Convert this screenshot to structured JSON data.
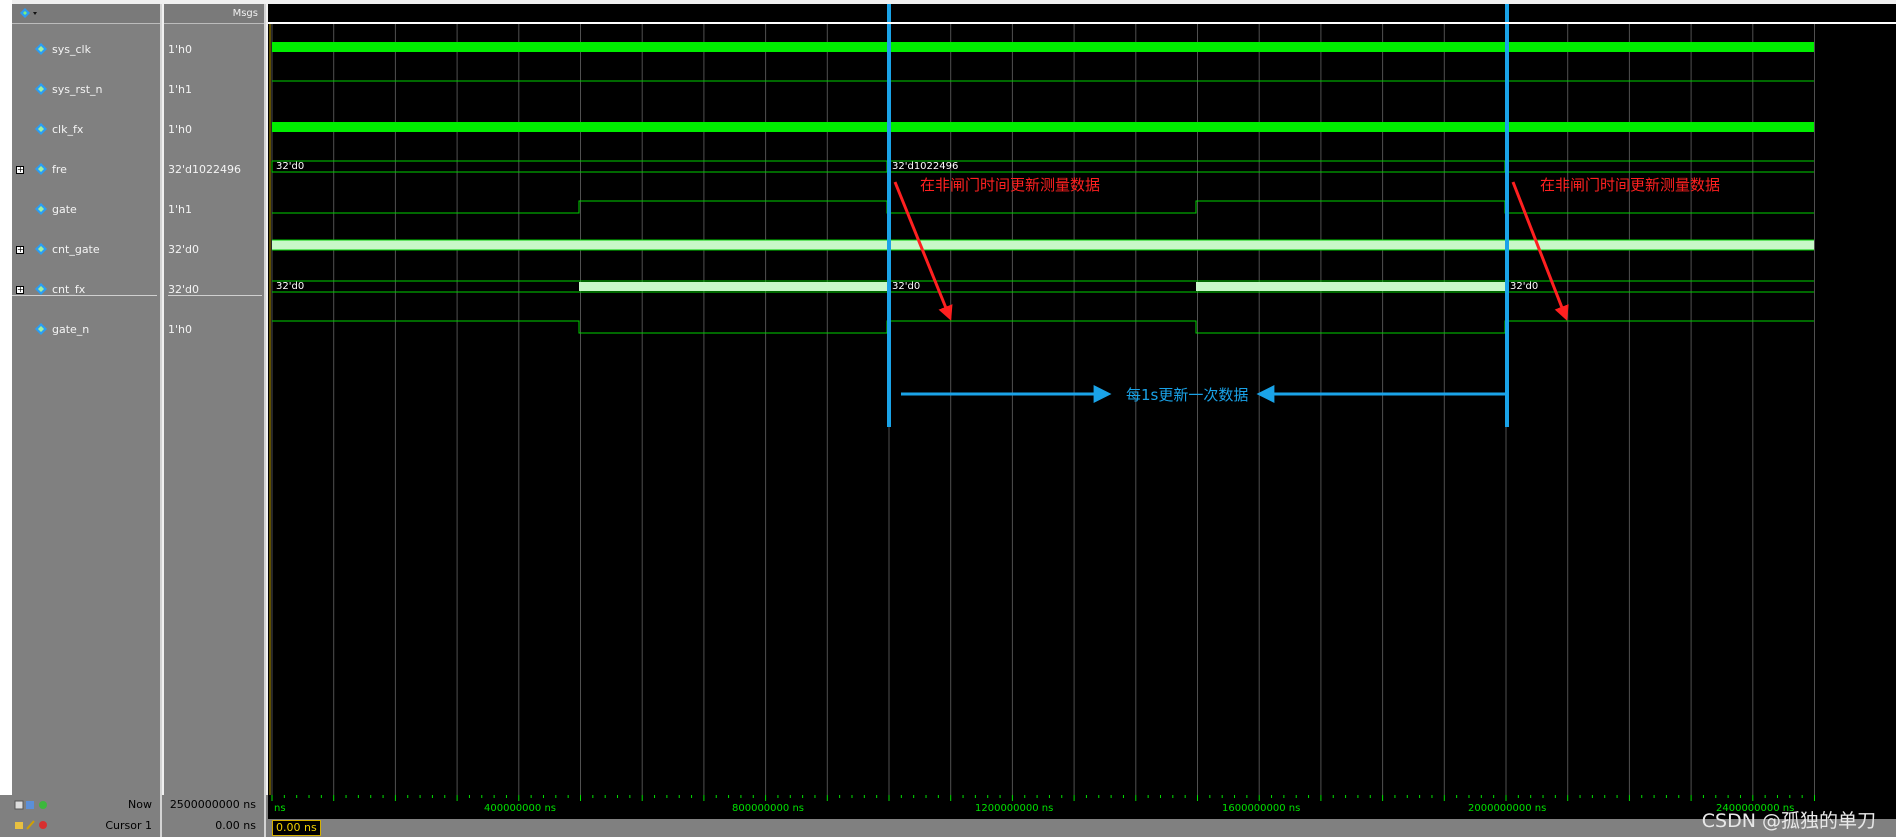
{
  "header": {
    "msgs_label": "Msgs"
  },
  "signals": [
    {
      "name": "sys_clk",
      "value": "1'h0",
      "expandable": false
    },
    {
      "name": "sys_rst_n",
      "value": "1'h1",
      "expandable": false
    },
    {
      "name": "clk_fx",
      "value": "1'h0",
      "expandable": false
    },
    {
      "name": "fre",
      "value": "32'd1022496",
      "expandable": true
    },
    {
      "name": "gate",
      "value": "1'h1",
      "expandable": false
    },
    {
      "name": "cnt_gate",
      "value": "32'd0",
      "expandable": true
    },
    {
      "name": "cnt_fx",
      "value": "32'd0",
      "expandable": true
    },
    {
      "name": "gate_n",
      "value": "1'h0",
      "expandable": false
    }
  ],
  "wave_labels": {
    "fre_start": "32'd0",
    "fre_mid": "32'd1022496",
    "cnt_fx_start": "32'd0",
    "cnt_fx_mid1": "32'd0",
    "cnt_fx_mid2": "32'd0"
  },
  "annotations": {
    "red_1": "在非闸门时间更新测量数据",
    "red_2": "在非闸门时间更新测量数据",
    "blue": "每1s更新一次数据"
  },
  "bottom": {
    "now_label": "Now",
    "now_value": "2500000000 ns",
    "cursor_label": "Cursor 1",
    "cursor_value": "0.00 ns",
    "cursor_box": "0.00 ns"
  },
  "timeline": {
    "ticks": [
      "ns",
      "400000000 ns",
      "800000000 ns",
      "1200000000 ns",
      "1600000000 ns",
      "2000000000 ns",
      "2400000000 ns"
    ]
  },
  "watermark": "CSDN @孤独的单刀",
  "colors": {
    "wave_green": "#00e000",
    "bus_fill": "#c8f8c8",
    "cursor_blue": "#1aa3e8",
    "annot_red": "#ff2020"
  }
}
